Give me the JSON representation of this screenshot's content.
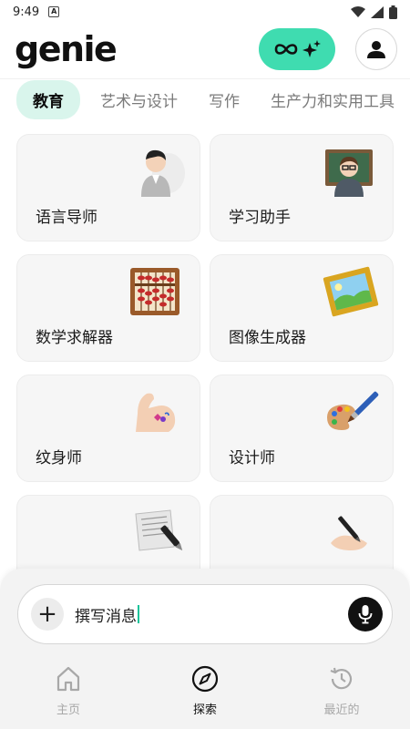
{
  "status_bar": {
    "time": "9:49",
    "notification_icon": "a-square-icon",
    "wifi_icon": "wifi-icon",
    "signal_icon": "signal-icon",
    "battery_icon": "battery-icon"
  },
  "header": {
    "logo": "genie",
    "pro_icons": [
      "infinity-icon",
      "sparkle-icon"
    ],
    "profile_icon": "person-icon"
  },
  "tabs": [
    {
      "label": "教育",
      "active": true
    },
    {
      "label": "艺术与设计",
      "active": false
    },
    {
      "label": "写作",
      "active": false
    },
    {
      "label": "生产力和实用工具",
      "active": false
    }
  ],
  "cards": [
    {
      "label": "语言导师",
      "icon": "tutor-person-icon"
    },
    {
      "label": "学习助手",
      "icon": "teacher-chalkboard-icon"
    },
    {
      "label": "数学求解器",
      "icon": "abacus-icon"
    },
    {
      "label": "图像生成器",
      "icon": "framed-picture-icon"
    },
    {
      "label": "纹身师",
      "icon": "tattooed-arm-icon"
    },
    {
      "label": "设计师",
      "icon": "palette-icon"
    },
    {
      "label": "",
      "icon": "paper-writing-icon"
    },
    {
      "label": "",
      "icon": "writing-hand-icon"
    }
  ],
  "composer": {
    "placeholder": "撰写消息",
    "plus_icon": "plus-icon",
    "mic_icon": "microphone-icon"
  },
  "bottom_nav": [
    {
      "label": "主页",
      "icon": "home-icon",
      "active": false
    },
    {
      "label": "探索",
      "icon": "compass-icon",
      "active": true
    },
    {
      "label": "最近的",
      "icon": "history-icon",
      "active": false
    }
  ],
  "colors": {
    "accent": "#3fdcb0",
    "tab_active_bg": "#d9f5ec",
    "card_bg": "#f6f6f6",
    "caret": "#15c39a"
  }
}
